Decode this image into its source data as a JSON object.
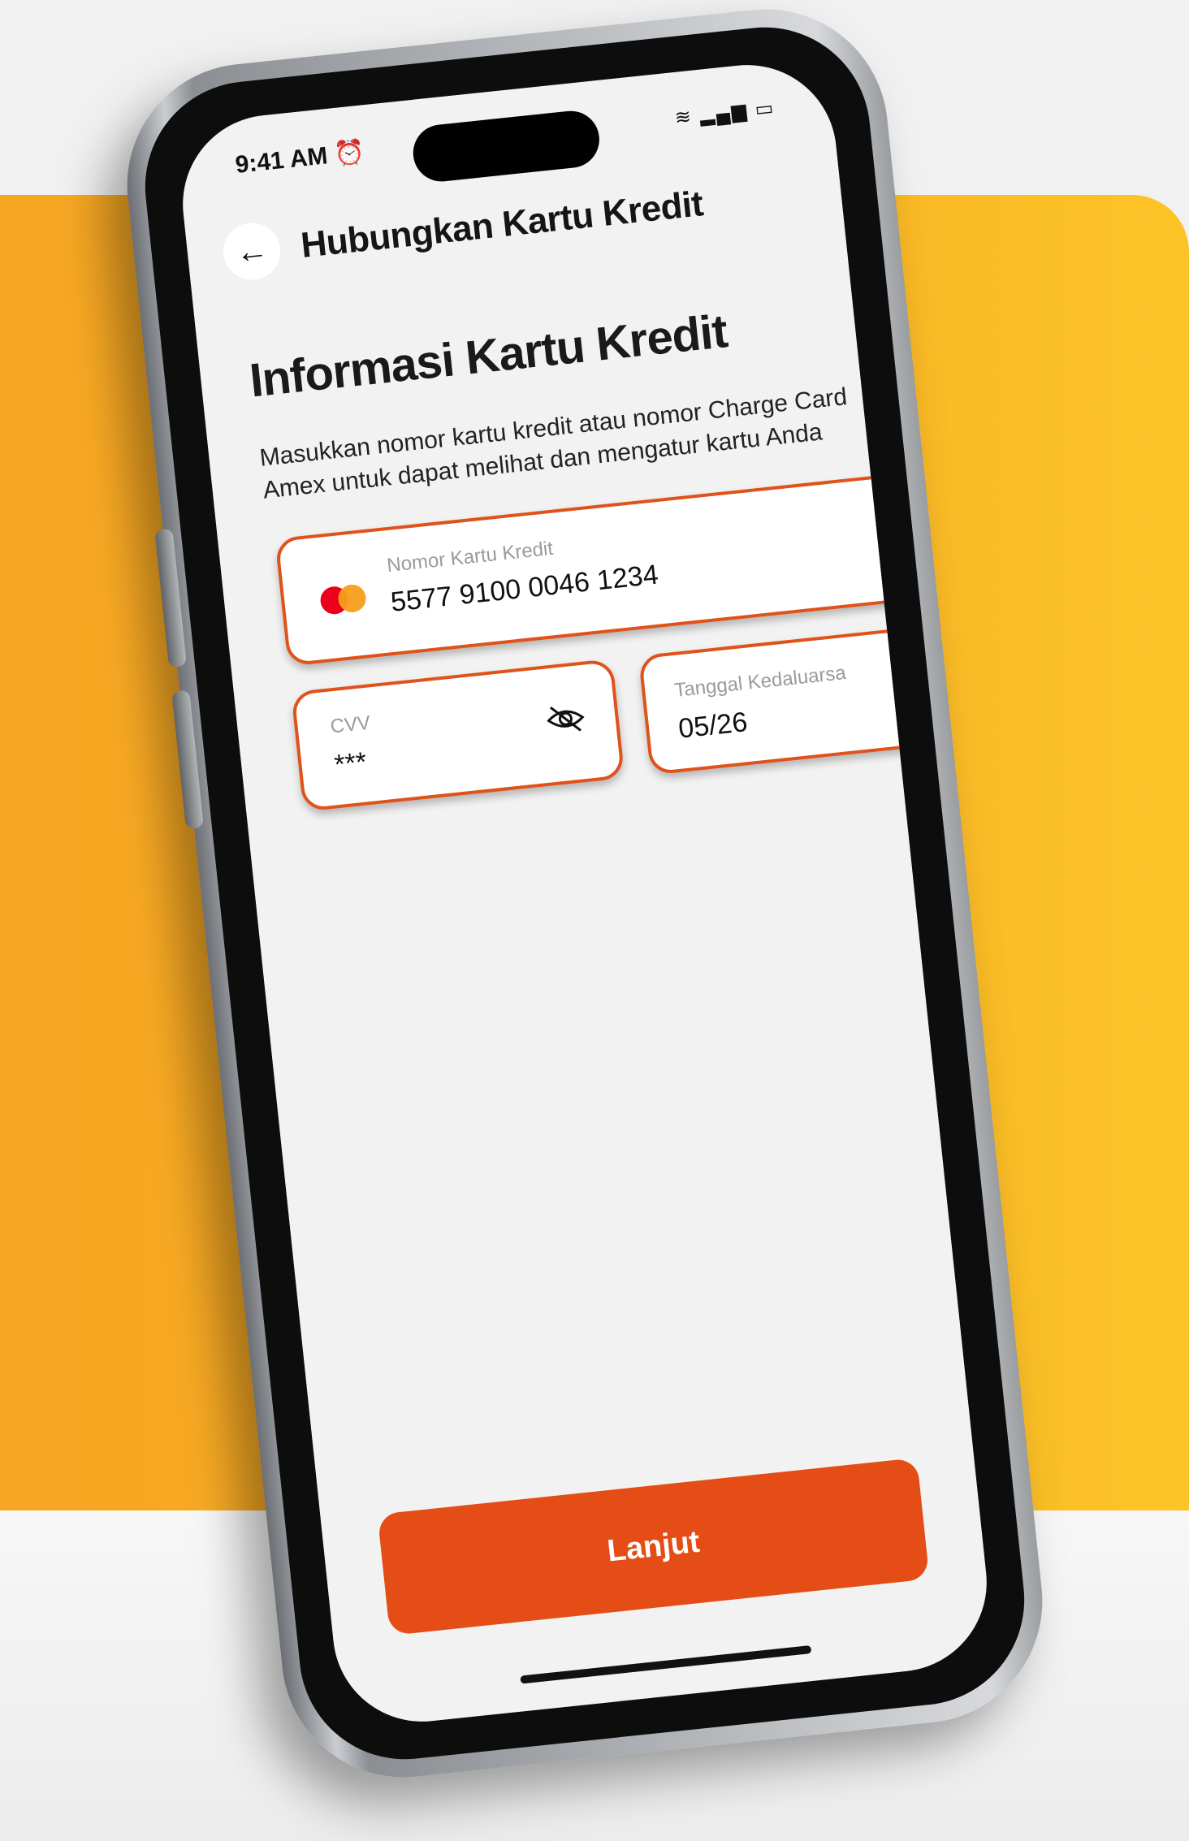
{
  "status_bar": {
    "time": "9:41 AM",
    "alarm_icon": "alarm-icon",
    "right_icons": "wifi-icon signal-icon battery-icon"
  },
  "header": {
    "back_icon": "arrow-left-icon",
    "title": "Hubungkan Kartu Kredit"
  },
  "form": {
    "section_title": "Informasi Kartu Kredit",
    "description": "Masukkan nomor kartu kredit atau nomor Charge Card Amex untuk dapat melihat dan mengatur kartu Anda",
    "card_number": {
      "label": "Nomor Kartu Kredit",
      "value": "5577 9100 0046 1234",
      "brand_icon": "mastercard-icon"
    },
    "cvv": {
      "label": "CVV",
      "value": "***",
      "toggle_icon": "eye-off-icon"
    },
    "expiry": {
      "label": "Tanggal Kedaluarsa",
      "value": "05/26"
    }
  },
  "actions": {
    "continue_label": "Lanjut"
  },
  "colors": {
    "accent": "#e44d15",
    "background_yellow": "#f9b124"
  }
}
